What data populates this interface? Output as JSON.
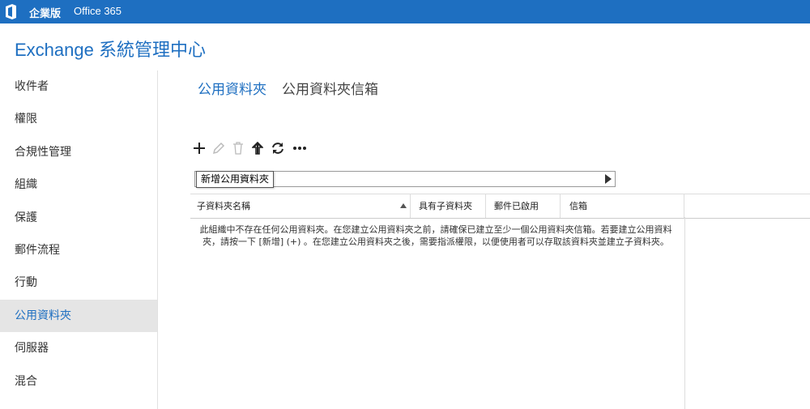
{
  "topbar": {
    "brand": "企業版",
    "product": "Office 365"
  },
  "app": {
    "title": "Exchange 系統管理中心"
  },
  "sidebar": {
    "items": [
      {
        "label": "收件者"
      },
      {
        "label": "權限"
      },
      {
        "label": "合規性管理"
      },
      {
        "label": "組織"
      },
      {
        "label": "保護"
      },
      {
        "label": "郵件流程"
      },
      {
        "label": "行動"
      },
      {
        "label": "公用資料夾",
        "active": true
      },
      {
        "label": "伺服器"
      },
      {
        "label": "混合"
      }
    ]
  },
  "tabs": [
    {
      "label": "公用資料夾",
      "active": true
    },
    {
      "label": "公用資料夾信箱"
    }
  ],
  "toolbar": {
    "icons": [
      "plus-icon",
      "pencil-icon",
      "trash-icon",
      "up-arrow-icon",
      "refresh-icon",
      "more-icon"
    ],
    "tooltip": "新增公用資料夾"
  },
  "table": {
    "columns": [
      "子資料夾名稱",
      "具有子資料夾",
      "郵件已啟用",
      "信箱"
    ],
    "empty_message": "此組織中不存在任何公用資料夾。在您建立公用資料夾之前，請確保已建立至少一個公用資料夾信箱。若要建立公用資料夾，請按一下 [新增] (+) 。在您建立公用資料夾之後，需要指派權限，以便使用者可以存取該資料夾並建立子資料夾。"
  },
  "colors": {
    "accent": "#1e6fc1",
    "active_nav_bg": "#e5e5e5"
  }
}
